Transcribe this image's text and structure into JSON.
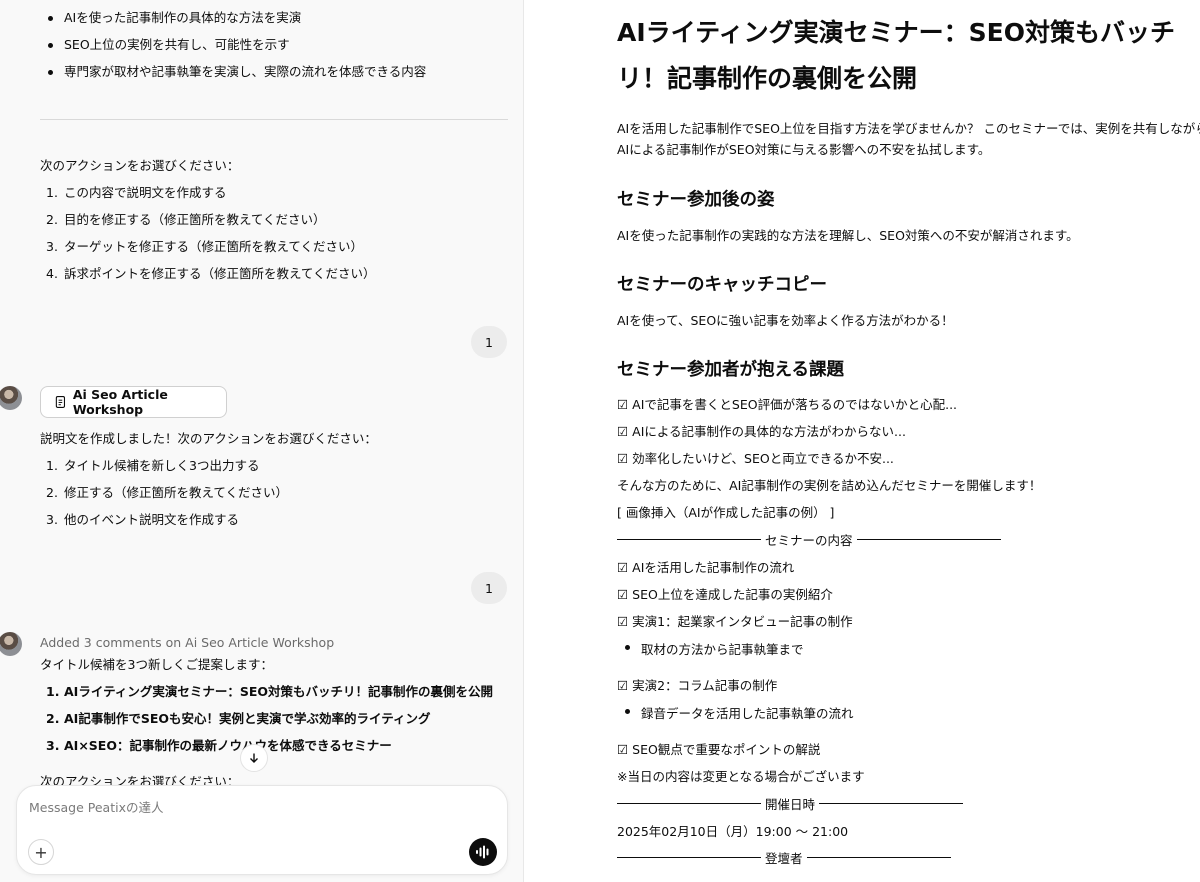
{
  "chat": {
    "top_bullets": [
      "AIを使った記事制作の具体的な方法を実演",
      "SEO上位の実例を共有し、可能性を示す",
      "専門家が取材や記事執筆を実演し、実際の流れを体感できる内容"
    ],
    "action_prompt_1": "次のアクションをお選びください：",
    "actions_1": [
      "この内容で説明文を作成する",
      "目的を修正する（修正箇所を教えてください）",
      "ターゲットを修正する（修正箇所を教えてください）",
      "訴求ポイントを修正する（修正箇所を教えてください）"
    ],
    "user_reply_1": "1",
    "canvas_chip_label": "Ai Seo Article Workshop",
    "assistant_text_2": "説明文を作成しました！次のアクションをお選びください：",
    "actions_2": [
      "タイトル候補を新しく3つ出力する",
      "修正する（修正箇所を教えてください）",
      "他のイベント説明文を作成する"
    ],
    "user_reply_2": "1",
    "comments_note": "Added 3 comments on Ai Seo Article Workshop",
    "assistant_text_3": "タイトル候補を3つ新しくご提案します：",
    "title_candidates": [
      "AIライティング実演セミナー：SEO対策もバッチリ！記事制作の裏側を公開",
      "AI記事制作でSEOも安心！実例と実演で学ぶ効率的ライティング",
      "AI×SEO：記事制作の最新ノウハウを体感できるセミナー"
    ],
    "action_prompt_3_partial": "次のアクションをお選びください：",
    "composer_placeholder": "Message Peatixの達人"
  },
  "doc": {
    "title": "AIライティング実演セミナー：SEO対策もバッチリ！記事制作の裏側を公開",
    "intro_1": "AIを活用した記事制作でSEO上位を目指す方法を学びませんか？ このセミナーでは、実例を共有しながら、",
    "intro_2": "AIによる記事制作がSEO対策に与える影響への不安を払拭します。",
    "h_after": "セミナー参加後の姿",
    "p_after": "AIを使った記事制作の実践的な方法を理解し、SEO対策への不安が解消されます。",
    "h_catch": "セミナーのキャッチコピー",
    "p_catch": "AIを使って、SEOに強い記事を効率よく作る方法がわかる！",
    "h_issues": "セミナー参加者が抱える課題",
    "issues": [
      "☑ AIで記事を書くとSEO評価が落ちるのではないかと心配...",
      "☑ AIによる記事制作の具体的な方法がわからない...",
      "☑ 効率化したいけど、SEOと両立できるか不安..."
    ],
    "for_you": "そんな方のために、AI記事制作の実例を詰め込んだセミナーを開催します！",
    "image_placeholder": "[ 画像挿入（AIが作成した記事の例） ]",
    "sep_content": "セミナーの内容",
    "contents": [
      "☑ AIを活用した記事制作の流れ",
      "☑ SEO上位を達成した記事の実例紹介",
      "☑ 実演1：起業家インタビュー記事の制作"
    ],
    "sub_1": "取材の方法から記事執筆まで",
    "demo_2": "☑ 実演2：コラム記事の制作",
    "sub_2": "録音データを活用した記事執筆の流れ",
    "seo_points": "☑ SEO観点で重要なポイントの解説",
    "note": "※当日の内容は変更となる場合がございます",
    "sep_date": "開催日時",
    "date": "2025年02月10日（月）19:00 〜 21:00",
    "sep_speaker": "登壇者"
  }
}
